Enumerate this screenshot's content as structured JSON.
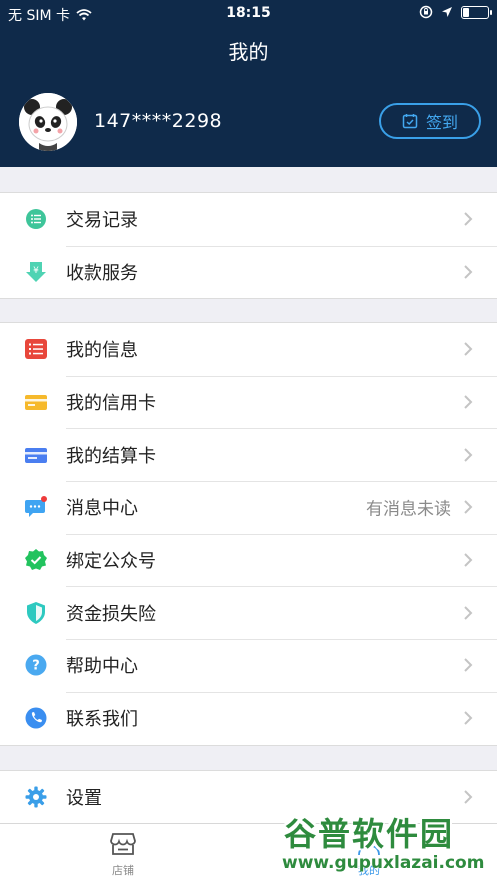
{
  "status_bar": {
    "carrier": "无 SIM 卡",
    "time": "18:15",
    "battery_level": 0.22
  },
  "header": {
    "title": "我的",
    "phone": "147****2298",
    "signin_label": "签到"
  },
  "group1": [
    {
      "label": "交易记录",
      "icon": "list-circle-icon"
    },
    {
      "label": "收款服务",
      "icon": "yen-arrow-icon"
    }
  ],
  "group2": [
    {
      "label": "我的信息",
      "icon": "info-list-icon"
    },
    {
      "label": "我的信用卡",
      "icon": "credit-card-icon"
    },
    {
      "label": "我的结算卡",
      "icon": "settlement-card-icon"
    },
    {
      "label": "消息中心",
      "icon": "message-icon",
      "extra": "有消息未读"
    },
    {
      "label": "绑定公众号",
      "icon": "badge-check-icon"
    },
    {
      "label": "资金损失险",
      "icon": "shield-icon"
    },
    {
      "label": "帮助中心",
      "icon": "help-icon"
    },
    {
      "label": "联系我们",
      "icon": "phone-icon"
    }
  ],
  "group3": [
    {
      "label": "设置",
      "icon": "gear-icon"
    }
  ],
  "tabbar": {
    "store_label": "店铺",
    "mine_label": "我的"
  },
  "watermark": {
    "brand": "谷普软件园",
    "url": "www.gupuxlazai.com"
  },
  "colors": {
    "header_bg": "#0f2a4a",
    "accent": "#3aa0e8"
  }
}
